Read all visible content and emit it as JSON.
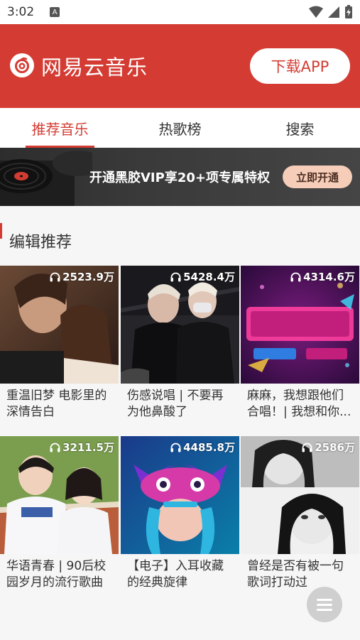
{
  "status_bar": {
    "time": "3:02",
    "notif_glyph": "A"
  },
  "header": {
    "brand_name": "网易云音乐",
    "download_label": "下载APP"
  },
  "tabs": [
    {
      "label": "推荐音乐"
    },
    {
      "label": "热歌榜"
    },
    {
      "label": "搜索"
    }
  ],
  "vip_banner": {
    "text": "开通黑胶VIP享20+项专属特权",
    "button_label": "立即开通"
  },
  "section": {
    "title": "编辑推荐"
  },
  "playlists": [
    {
      "play_count": "2523.9万",
      "title": "重温旧梦 电影里的深情告白"
    },
    {
      "play_count": "5428.4万",
      "title": "伤感说唱 | 不要再为他鼻酸了"
    },
    {
      "play_count": "4314.6万",
      "title": "麻麻，我想跟他们合唱！| 我想和你..."
    },
    {
      "play_count": "3211.5万",
      "title": "华语青春 | 90后校园岁月的流行歌曲"
    },
    {
      "play_count": "4485.8万",
      "title": "【电子】入耳收藏的经典旋律"
    },
    {
      "play_count": "2586万",
      "title": "曾经是否有被一句歌词打动过"
    }
  ],
  "colors": {
    "brand_red": "#d43c33",
    "vip_gold": "#f5cdb8"
  }
}
